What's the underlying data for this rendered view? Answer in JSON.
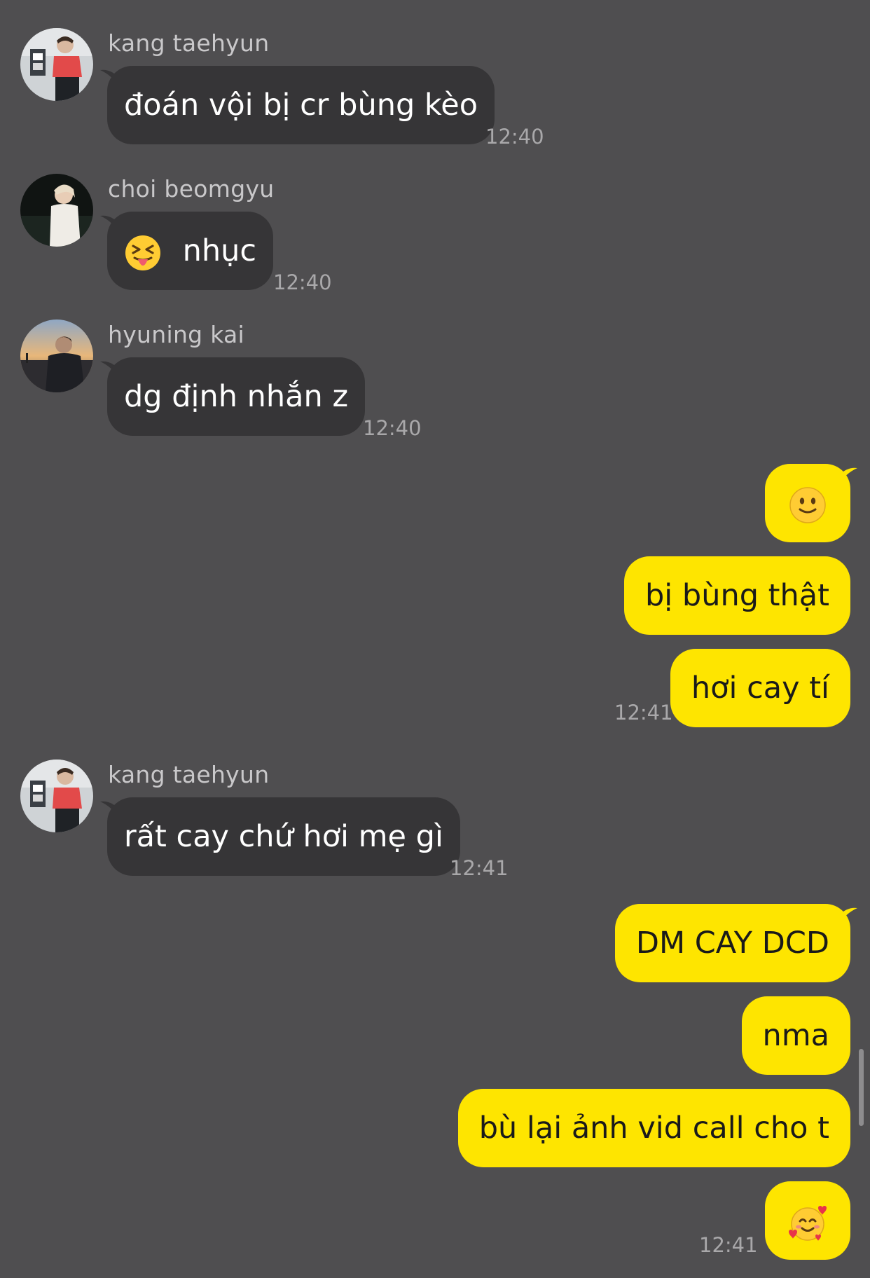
{
  "colors": {
    "background": "#4f4e50",
    "incoming_bubble": "#363537",
    "outgoing_bubble": "#fee500",
    "sender_name": "#c9c8ca",
    "timestamp": "#a9a8aa"
  },
  "messages": [
    {
      "sender": "kang taehyun",
      "avatar": "avatar-kang-taehyun",
      "text": "đoán vội bị cr bùng kèo",
      "time": "12:40"
    },
    {
      "sender": "choi beomgyu",
      "avatar": "avatar-choi-beomgyu",
      "emoji": "squinting-tongue-emoji",
      "text": "nhục",
      "time": "12:40"
    },
    {
      "sender": "hyuning kai",
      "avatar": "avatar-hyuning-kai",
      "text": "dg định nhắn z",
      "time": "12:40"
    }
  ],
  "outgoing_group_1": {
    "items": [
      {
        "emoji": "slightly-smiling-face-emoji"
      },
      {
        "text": "bị bùng thật"
      },
      {
        "text": "hơi cay tí"
      }
    ],
    "time": "12:41"
  },
  "incoming_2": {
    "sender": "kang taehyun",
    "avatar": "avatar-kang-taehyun",
    "text": "rất cay chứ hơi mẹ gì",
    "time": "12:41"
  },
  "outgoing_group_2": {
    "items": [
      {
        "text": "DM CAY DCD"
      },
      {
        "text": "nma"
      },
      {
        "text": "bù lại ảnh vid call cho t"
      },
      {
        "emoji": "smiling-face-with-hearts-emoji"
      }
    ],
    "time": "12:41"
  }
}
